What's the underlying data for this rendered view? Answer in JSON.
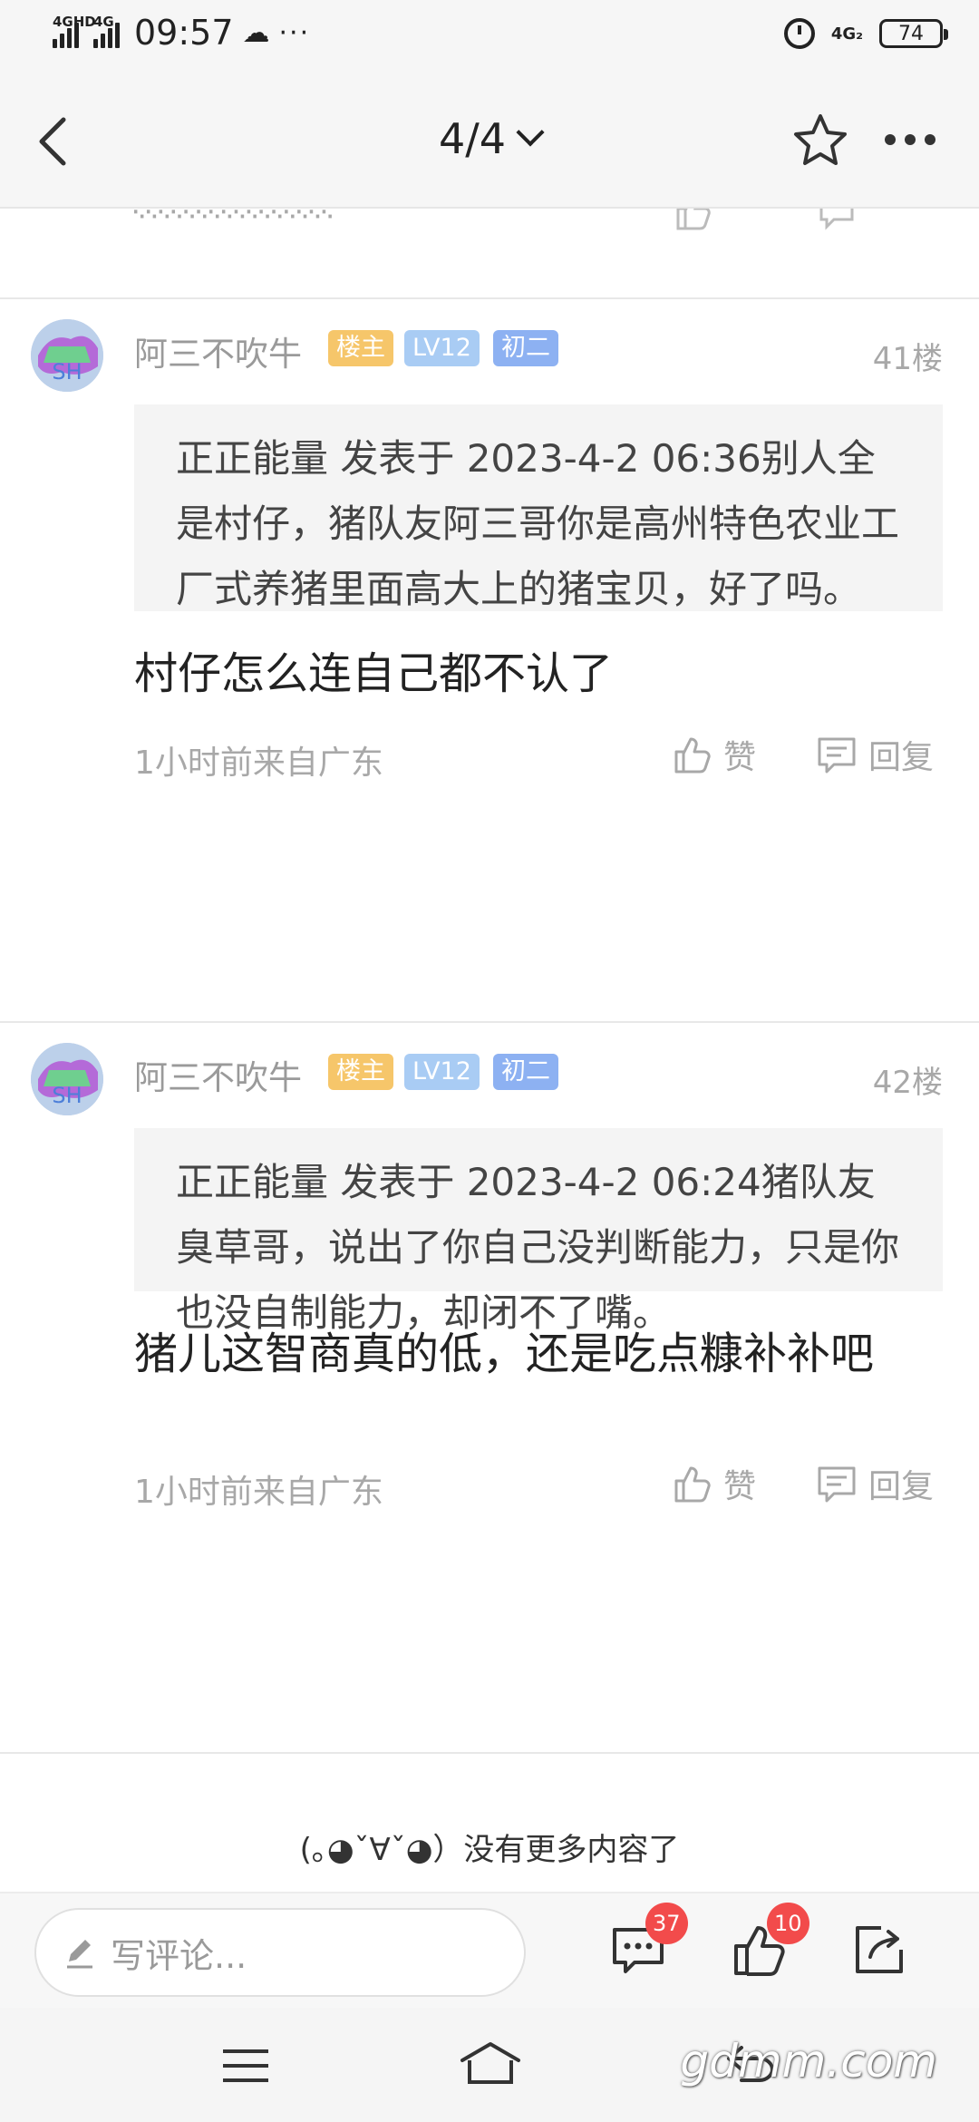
{
  "status_bar": {
    "network_left": "4GHD",
    "network_left2": "4G",
    "time": "09:57",
    "network_right": "4G₂",
    "battery": "74"
  },
  "nav": {
    "page_indicator": "4/4"
  },
  "posts": [
    {
      "username": "阿三不吹牛",
      "tags": [
        "楼主",
        "LV12",
        "初二"
      ],
      "floor": "41楼",
      "quote": "正正能量 发表于 2023-4-2 06:36别人全是村仔，猪队友阿三哥你是高州特色农业工厂式养猪里面高大上的猪宝贝，好了吗。",
      "text": "村仔怎么连自己都不认了",
      "meta": "1小时前来自广东",
      "like_label": "赞",
      "reply_label": "回复"
    },
    {
      "username": "阿三不吹牛",
      "tags": [
        "楼主",
        "LV12",
        "初二"
      ],
      "floor": "42楼",
      "quote": "正正能量 发表于 2023-4-2 06:24猪队友臭草哥，说出了你自己没判断能力，只是你也没自制能力，却闭不了嘴。",
      "text": "猪儿这智商真的低，还是吃点糠补补吧",
      "meta": "1小时前来自广东",
      "like_label": "赞",
      "reply_label": "回复"
    }
  ],
  "end_text": "(｡◕ˇ∀ˇ◕）没有更多内容了",
  "comment_bar": {
    "placeholder": "写评论...",
    "comments_count": "37",
    "likes_count": "10"
  },
  "watermark": "gdmm.com",
  "colors": {
    "tag_owner": "#f6c66a",
    "tag_level": "#a9ccf4",
    "tag_grade": "#8db1f2",
    "badge": "#f24b4b"
  }
}
